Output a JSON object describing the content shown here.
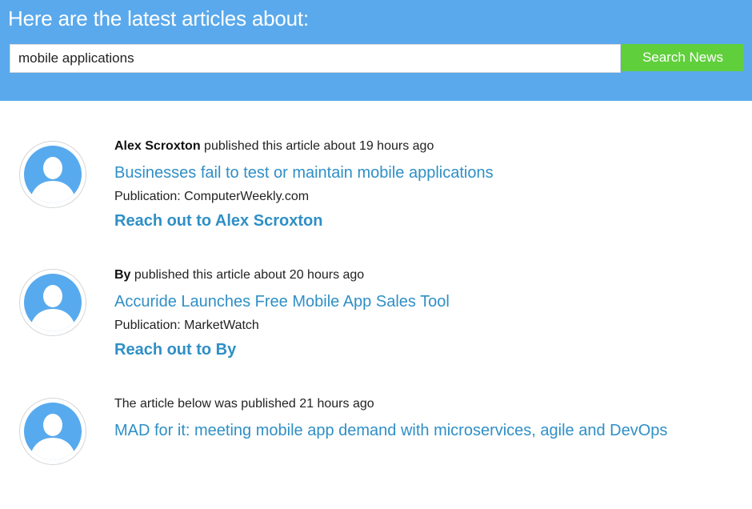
{
  "header": {
    "title": "Here are the latest articles about:",
    "search_value": "mobile applications",
    "search_button_label": "Search News"
  },
  "articles": [
    {
      "author": "Alex Scroxton",
      "byline_rest": " published this article about 19 hours ago",
      "title": "Businesses fail to test or maintain mobile applications",
      "publication": "Publication: ComputerWeekly.com",
      "reach_out": "Reach out to Alex Scroxton"
    },
    {
      "author": "By",
      "byline_rest": " published this article about 20 hours ago",
      "title": "Accuride Launches Free Mobile App Sales Tool",
      "publication": "Publication: MarketWatch",
      "reach_out": "Reach out to By"
    },
    {
      "byline": "The article below was published 21 hours ago",
      "title": "MAD for it: meeting mobile app demand with microservices, agile and DevOps"
    }
  ],
  "colors": {
    "header_bg": "#59a9ec",
    "button_bg": "#60cf3c",
    "link": "#2f8fc6",
    "avatar": "#58aaee"
  },
  "icons": {
    "avatar": "user-silhouette-icon"
  }
}
